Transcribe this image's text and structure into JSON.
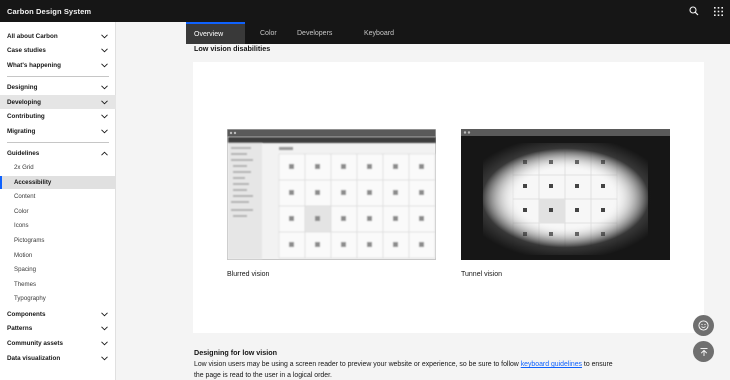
{
  "header": {
    "brand": "Carbon Design System",
    "icons": [
      "search-icon",
      "app-switcher-icon"
    ]
  },
  "sidebar": {
    "top_items": [
      {
        "label": "All about Carbon"
      },
      {
        "label": "Case studies"
      },
      {
        "label": "What's happening"
      },
      {
        "label": "Designing"
      },
      {
        "label": "Developing"
      },
      {
        "label": "Contributing"
      },
      {
        "label": "Migrating"
      }
    ],
    "guidelines": {
      "label": "Guidelines",
      "children": [
        {
          "label": "2x Grid"
        },
        {
          "label": "Accessibility"
        },
        {
          "label": "Content"
        },
        {
          "label": "Color"
        },
        {
          "label": "Icons"
        },
        {
          "label": "Pictograms"
        },
        {
          "label": "Motion"
        },
        {
          "label": "Spacing"
        },
        {
          "label": "Themes"
        },
        {
          "label": "Typography"
        }
      ]
    },
    "bottom_items": [
      {
        "label": "Components"
      },
      {
        "label": "Patterns"
      },
      {
        "label": "Community assets"
      },
      {
        "label": "Data visualization"
      }
    ]
  },
  "tabs": [
    {
      "label": "Overview"
    },
    {
      "label": "Color"
    },
    {
      "label": "Developers"
    },
    {
      "label": "Keyboard"
    }
  ],
  "main": {
    "section_title": "Low vision disabilities",
    "figures": [
      {
        "caption": "Blurred vision"
      },
      {
        "caption": "Tunnel vision"
      }
    ],
    "section2_title": "Designing for low vision",
    "paragraph_before": "Low vision users may be using a screen reader to preview your website or experience, so be sure to follow ",
    "paragraph_link": "keyboard guidelines",
    "paragraph_after": " to ensure the page is read to the user in a logical order."
  },
  "fabs": [
    "feedback-icon",
    "back-to-top-icon"
  ],
  "colors": {
    "header_bg": "#161616",
    "accent": "#0f62fe",
    "page_bg": "#f4f4f4",
    "active_tab_bg": "#393939"
  }
}
